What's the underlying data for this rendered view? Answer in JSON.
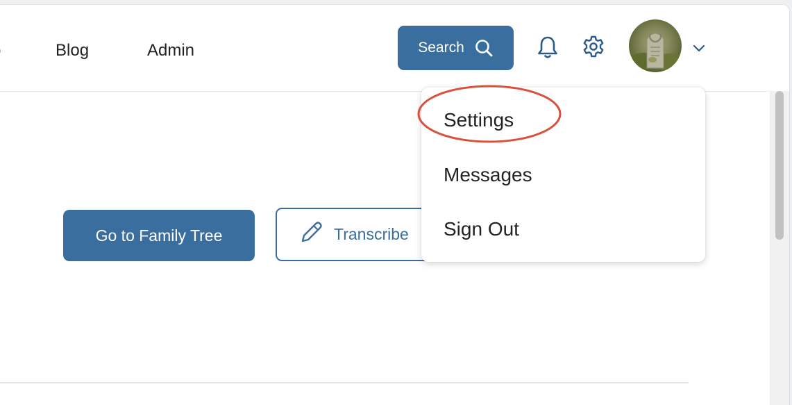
{
  "header": {
    "nav": {
      "partial_label": "p",
      "blog_label": "Blog",
      "admin_label": "Admin"
    },
    "search_label": "Search",
    "search_icon": "search-icon",
    "notification_icon": "bell-icon",
    "settings_icon": "gear-icon",
    "avatar": "user-avatar",
    "menu_toggle_icon": "chevron-down-icon"
  },
  "main": {
    "family_tree_button_label": "Go to Family Tree",
    "transcribe_button_label": "Transcribe",
    "transcribe_icon": "pencil-icon"
  },
  "dropdown": {
    "items": [
      {
        "label": "Settings"
      },
      {
        "label": "Messages"
      },
      {
        "label": "Sign Out"
      }
    ],
    "highlighted_item": "Settings"
  },
  "colors": {
    "primary": "#3a6e9e",
    "highlight_annotation": "#d9503c",
    "text": "#222222"
  }
}
